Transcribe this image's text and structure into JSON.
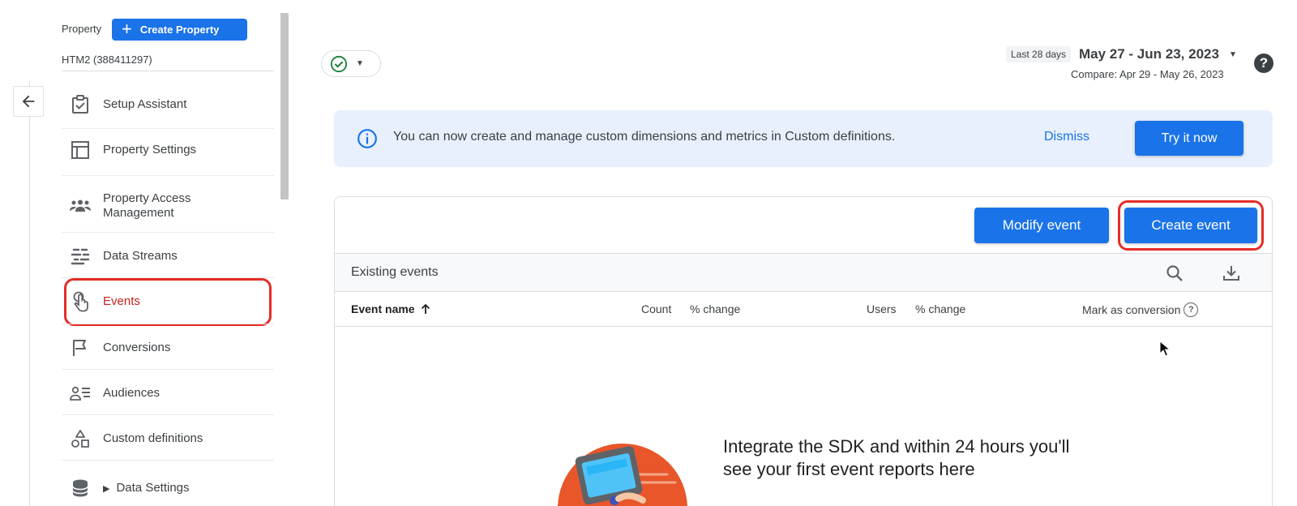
{
  "sidebar": {
    "property_label": "Property",
    "create_property_label": "Create Property",
    "property_name": "HTM2 (388411297)",
    "items": [
      {
        "label": "Setup Assistant",
        "icon": "checklist-icon"
      },
      {
        "label": "Property Settings",
        "icon": "layout-icon"
      },
      {
        "label": "Property Access\nManagement",
        "icon": "people-icon"
      },
      {
        "label": "Data Streams",
        "icon": "streams-icon"
      },
      {
        "label": "Events",
        "icon": "touch-icon",
        "active": true
      },
      {
        "label": "Conversions",
        "icon": "flag-icon"
      },
      {
        "label": "Audiences",
        "icon": "audience-icon"
      },
      {
        "label": "Custom definitions",
        "icon": "shapes-icon"
      },
      {
        "label": "Data Settings",
        "icon": "database-icon"
      }
    ]
  },
  "topbar": {
    "date_badge": "Last 28 days",
    "date_range": "May 27 - Jun 23, 2023",
    "compare": "Compare: Apr 29 - May 26, 2023"
  },
  "banner": {
    "message": "You can now create and manage custom dimensions and metrics in Custom definitions.",
    "dismiss_label": "Dismiss",
    "try_label": "Try it now"
  },
  "events": {
    "modify_label": "Modify event",
    "create_label": "Create event",
    "section_title": "Existing events",
    "columns": {
      "name": "Event name",
      "count": "Count",
      "pct_change_1": "% change",
      "users": "Users",
      "pct_change_2": "% change",
      "mark": "Mark as conversion"
    },
    "empty_text": "Integrate the SDK and within 24 hours you'll see your first event reports here"
  },
  "colors": {
    "primary": "#1a73e8",
    "banner_bg": "#e8f0fe",
    "highlight": "#e52d27",
    "active_text": "#c5221f"
  }
}
